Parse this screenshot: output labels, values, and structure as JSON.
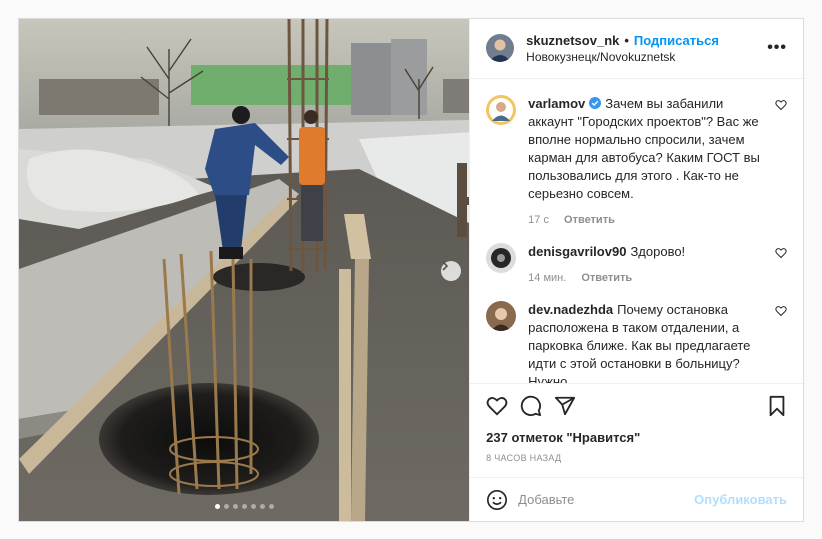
{
  "header": {
    "username": "skuznetsov_nk",
    "separator": "•",
    "follow_label": "Подписаться",
    "location": "Новокузнецк/Novokuznetsk",
    "more_label": "•••"
  },
  "comments": [
    {
      "username": "varlamov",
      "text": "Зачем вы забанили аккаунт \"Городских проектов\"? Вас же вполне нормально спросили, зачем карман для автобуса? Каким ГОСТ вы пользовались для этого . Как-то не серьезно совсем.",
      "time": "17 с",
      "reply_label": "Ответить"
    },
    {
      "username": "denisgavrilov90",
      "text": "Здорово!",
      "time": "14 мин.",
      "reply_label": "Ответить"
    },
    {
      "username": "dev.nadezhda",
      "text": "Почему остановка расположена в таком отдалении, а парковка ближе. Как вы предлагаете идти с этой остановки в больницу? Нужно",
      "time": "",
      "reply_label": ""
    }
  ],
  "post": {
    "likes": "237 отметок \"Нравится\"",
    "time": "8 ЧАСОВ НАЗАД"
  },
  "add_comment": {
    "placeholder": "Добавьте",
    "publish_label": "Опубликовать"
  },
  "carousel": {
    "slide_count": 7,
    "active_slide": 1
  },
  "colors": {
    "link": "#0095f6",
    "publish_disabled": "#b2dffc",
    "muted": "#8e8e8e",
    "verified": "#3897f0"
  },
  "icons": [
    "heart-icon",
    "comment-icon",
    "share-icon",
    "bookmark-icon",
    "emoji-icon",
    "verified-icon",
    "chevron-right-icon",
    "more-icon"
  ]
}
